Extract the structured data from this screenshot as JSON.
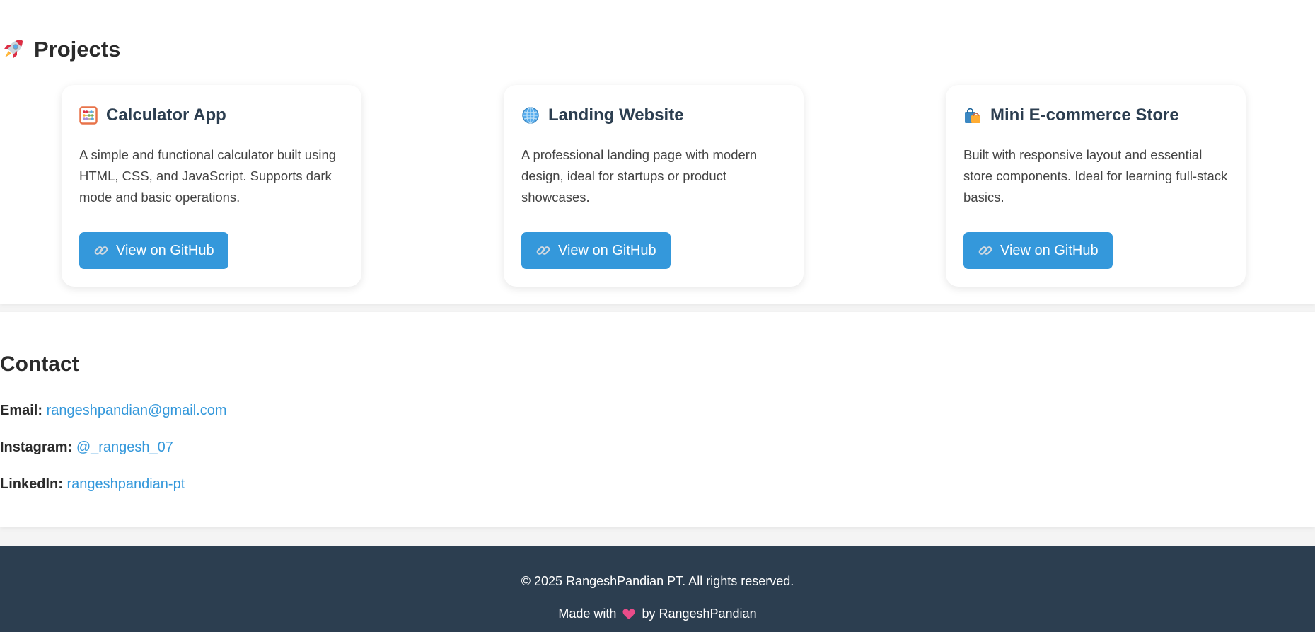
{
  "projects": {
    "title": "Projects",
    "icon": "rocket-icon",
    "cards": [
      {
        "title": "Calculator App",
        "icon": "abacus-icon",
        "description": "A simple and functional calculator built using HTML, CSS, and JavaScript. Supports dark mode and basic operations.",
        "button": "View on GitHub"
      },
      {
        "title": "Landing Website",
        "icon": "globe-icon",
        "description": "A professional landing page with modern design, ideal for startups or product showcases.",
        "button": "View on GitHub"
      },
      {
        "title": "Mini E-commerce Store",
        "icon": "shopping-bags-icon",
        "description": "Built with responsive layout and essential store components. Ideal for learning full-stack basics.",
        "button": "View on GitHub"
      }
    ]
  },
  "contact": {
    "title": "Contact",
    "email_label": "Email:",
    "email": "rangeshpandian@gmail.com",
    "instagram_label": "Instagram:",
    "instagram": "@_rangesh_07",
    "linkedin_label": "LinkedIn:",
    "linkedin": "rangeshpandian-pt"
  },
  "footer": {
    "copyright": "© 2025 RangeshPandian PT. All rights reserved.",
    "made_with": "Made with",
    "by": "by RangeshPandian"
  },
  "colors": {
    "accent": "#3498db",
    "footer_bg": "#2c3e50",
    "card_title": "#2c3e50"
  }
}
